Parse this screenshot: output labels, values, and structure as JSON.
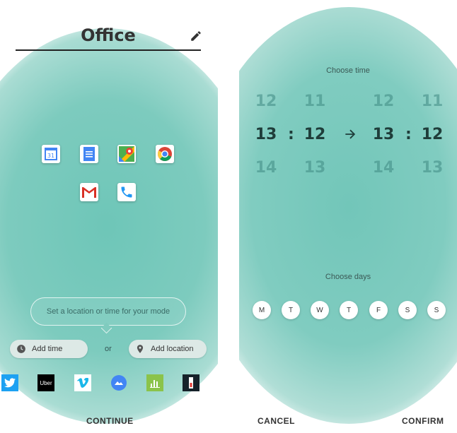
{
  "mode": {
    "title": "Office"
  },
  "prompt_text": "Set a location or time for your mode",
  "add_time_label": "Add time",
  "or_label": "or",
  "add_location_label": "Add location",
  "continue_label": "CONTINUE",
  "calendar_day": "31",
  "uber_label": "Uber",
  "time_picker": {
    "choose_time_label": "Choose time",
    "start": {
      "hour_prev": "12",
      "hour": "13",
      "hour_next": "14",
      "minute_prev": "11",
      "minute": "12",
      "minute_next": "13"
    },
    "end": {
      "hour_prev": "12",
      "hour": "13",
      "hour_next": "14",
      "minute_prev": "11",
      "minute": "12",
      "minute_next": "13"
    },
    "separator": ":"
  },
  "choose_days_label": "Choose days",
  "days": [
    "M",
    "T",
    "W",
    "T",
    "F",
    "S",
    "S"
  ],
  "cancel_label": "CANCEL",
  "confirm_label": "CONFIRM",
  "colors": {
    "teal": "#7dcbbe",
    "dark_text": "#1f3d3a"
  }
}
